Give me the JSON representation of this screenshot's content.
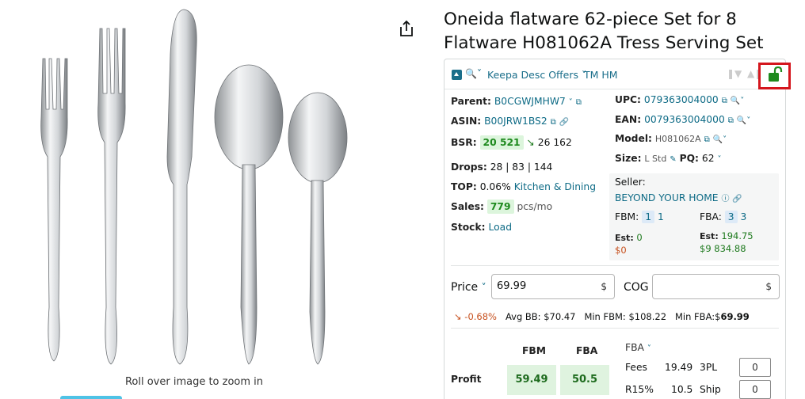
{
  "image": {
    "zoom_hint": "Roll over image to zoom in"
  },
  "product": {
    "title_line1": "Oneida flatware 62-piece Set for 8",
    "title_line2": "Flatware H081062A Tress Serving Set"
  },
  "keepa": {
    "toolbar": {
      "link1": "Keepa Desc Offers",
      "link2": "TM HM"
    },
    "parent": {
      "label": "Parent:",
      "value": "B0CGWJMHW7"
    },
    "asin": {
      "label": "ASIN:",
      "value": "B00JRW1BS2"
    },
    "bsr": {
      "label": "BSR:",
      "value": "20 521",
      "trend": "26 162"
    },
    "drops": {
      "label": "Drops:",
      "value": "28 | 83 | 144"
    },
    "top": {
      "label": "TOP:",
      "value": "0.06%",
      "category": "Kitchen & Dining"
    },
    "sales": {
      "label": "Sales:",
      "value": "779",
      "unit": "pcs/mo"
    },
    "stock": {
      "label": "Stock:",
      "value": "Load"
    },
    "upc": {
      "label": "UPC:",
      "value": "079363004000"
    },
    "ean": {
      "label": "EAN:",
      "value": "0079363004000"
    },
    "model": {
      "label": "Model:",
      "value": "H081062A"
    },
    "size": {
      "label": "Size:",
      "value": "L Std",
      "pq_label": "PQ:",
      "pq_value": "62"
    },
    "seller": {
      "label": "Seller:",
      "name": "BEYOND YOUR HOME",
      "fbm_label": "FBM:",
      "fbm_count": "1",
      "fbm_count2": "1",
      "fba_label": "FBA:",
      "fba_count": "3",
      "fba_count2": "3",
      "est_fbm_label": "Est:",
      "est_fbm_value": "0",
      "est_fbm_money": "$0",
      "est_fba_label": "Est:",
      "est_fba_value": "194.75",
      "est_fba_money": "$9 834.88"
    },
    "pricing": {
      "price_label": "Price",
      "price_value": "69.99",
      "price_currency": "$",
      "cog_label": "COG",
      "cog_value": "",
      "cog_currency": "$"
    },
    "stats": {
      "change": "-0.68%",
      "avg_bb_label": "Avg BB:",
      "avg_bb_value": "$70.47",
      "min_fbm_label": "Min FBM:",
      "min_fbm_value": "$108.22",
      "min_fba_label": "Min FBA:",
      "min_fba_currency": "$",
      "min_fba_value": "69.99"
    },
    "profit": {
      "label": "Profit",
      "fbm_header": "FBM",
      "fba_header": "FBA",
      "fbm_value": "59.49",
      "fba_value": "50.5",
      "mode_select": "FBA",
      "fees_label": "Fees",
      "fees_value": "19.49",
      "threepl_label": "3PL",
      "threepl_value": "0",
      "r15_label": "R15%",
      "r15_value": "10.5",
      "ship_label": "Ship",
      "ship_value": "0"
    }
  },
  "colors": {
    "link_teal": "#0e6b86",
    "badge_green": "#dcf5dc",
    "lock_border": "#d4161d",
    "lock_green": "#1e8a1e"
  }
}
